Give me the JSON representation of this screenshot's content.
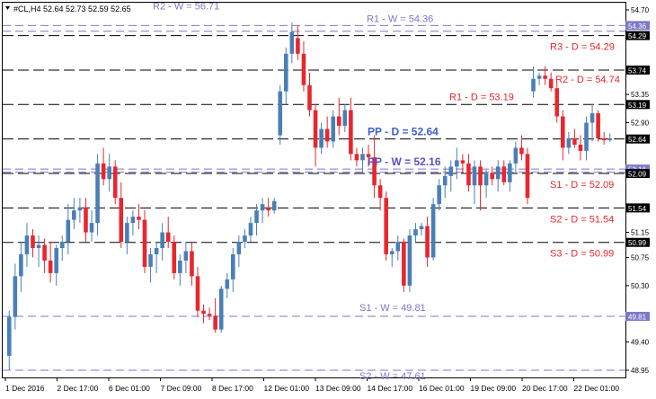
{
  "symbol_header": "#CL,H4  52.64 52.73 52.59 52.65",
  "colors": {
    "bull": "#4a7fb5",
    "bear": "#e8262e",
    "daily": "#000000",
    "weekly": "#7b78c8",
    "daily_text": "#e8262e",
    "pp_daily_text": "#3a5fcd",
    "pp_weekly_text": "#5a4fc0"
  },
  "chart_data": {
    "type": "candlestick",
    "title": "#CL,H4  52.64 52.73 52.59 52.65",
    "ylim": [
      48.95,
      54.7
    ],
    "y_ticks": [
      "54.70",
      "54.29",
      "53.74",
      "53.35",
      "52.90",
      "52.64",
      "52.09",
      "51.54",
      "51.15",
      "50.99",
      "50.75",
      "50.30",
      "49.81",
      "49.40",
      "48.95"
    ],
    "x_tick_labels": [
      "1 Dec 2016",
      "2 Dec 17:00",
      "6 Dec 01:00",
      "7 Dec 09:00",
      "8 Dec 17:00",
      "12 Dec 01:00",
      "13 Dec 09:00",
      "14 Dec 17:00",
      "16 Dec 01:00",
      "19 Dec 09:00",
      "20 Dec 17:00",
      "22 Dec 01:00"
    ],
    "levels": [
      {
        "label": "R2 - W = 56.71",
        "value": 54.45,
        "kind": "weekly",
        "axis_label": "54.36",
        "text_pos": "left"
      },
      {
        "label": "R1 - W = 54.36",
        "value": 54.36,
        "kind": "weekly",
        "axis_label": "",
        "text_pos": "center"
      },
      {
        "label": "R3 - D = 54.29",
        "value": 54.29,
        "kind": "daily",
        "axis_label": "54.29",
        "text_pos": "right"
      },
      {
        "label": "R2 - D = 54.74",
        "value": 53.74,
        "kind": "daily",
        "axis_label": "53.74",
        "text_pos": "right2"
      },
      {
        "label": "R1 - D = 53.19",
        "value": 53.19,
        "kind": "daily",
        "axis_label": "53.19",
        "text_pos": "right1"
      },
      {
        "label": "PP - D = 52.64",
        "value": 52.64,
        "kind": "daily",
        "axis_label": "52.64",
        "text_pos": "pp"
      },
      {
        "label": "PP - W = 52.16",
        "value": 52.16,
        "kind": "weekly",
        "axis_label": "52.16",
        "text_pos": "ppw"
      },
      {
        "label": "",
        "value": 52.11,
        "kind": "weekly",
        "axis_label": "",
        "text_pos": "none"
      },
      {
        "label": "S1 - D = 52.09",
        "value": 52.09,
        "kind": "daily",
        "axis_label": "52.09",
        "text_pos": "right"
      },
      {
        "label": "S2 - D = 51.54",
        "value": 51.54,
        "kind": "daily",
        "axis_label": "51.54",
        "text_pos": "right"
      },
      {
        "label": "S3 - D = 50.99",
        "value": 50.99,
        "kind": "daily",
        "axis_label": "50.99",
        "text_pos": "right"
      },
      {
        "label": "S1 - W = 49.81",
        "value": 49.81,
        "kind": "weekly",
        "axis_label": "49.81",
        "text_pos": "center"
      },
      {
        "label": "S2 - W = 47.61",
        "value": 48.95,
        "kind": "weekly",
        "axis_label": "",
        "text_pos": "bottom"
      }
    ],
    "candles": [
      [
        49.18,
        49.9,
        48.95,
        49.8
      ],
      [
        49.8,
        50.65,
        49.6,
        50.45
      ],
      [
        50.45,
        51.0,
        50.2,
        50.8
      ],
      [
        50.8,
        51.3,
        50.6,
        51.1
      ],
      [
        51.1,
        51.2,
        50.75,
        50.9
      ],
      [
        50.9,
        51.1,
        50.6,
        50.95
      ],
      [
        50.95,
        51.05,
        50.5,
        50.7
      ],
      [
        50.7,
        51.0,
        50.35,
        50.5
      ],
      [
        50.5,
        50.95,
        50.3,
        50.9
      ],
      [
        50.9,
        51.1,
        50.7,
        51.0
      ],
      [
        51.0,
        51.6,
        50.8,
        51.35
      ],
      [
        51.35,
        51.7,
        51.2,
        51.5
      ],
      [
        51.5,
        51.7,
        51.3,
        51.55
      ],
      [
        51.55,
        51.7,
        51.0,
        51.15
      ],
      [
        51.15,
        51.5,
        51.0,
        51.3
      ],
      [
        51.3,
        52.4,
        51.1,
        52.25
      ],
      [
        52.25,
        52.5,
        51.9,
        52.0
      ],
      [
        52.0,
        52.4,
        51.8,
        52.2
      ],
      [
        52.2,
        52.3,
        51.6,
        51.7
      ],
      [
        51.7,
        51.95,
        50.9,
        51.0
      ],
      [
        51.0,
        51.4,
        50.8,
        51.3
      ],
      [
        51.3,
        51.5,
        51.1,
        51.4
      ],
      [
        51.4,
        51.6,
        51.2,
        51.35
      ],
      [
        51.35,
        51.5,
        50.5,
        50.6
      ],
      [
        50.6,
        50.9,
        50.35,
        50.8
      ],
      [
        50.8,
        51.0,
        50.5,
        50.9
      ],
      [
        50.9,
        51.3,
        50.7,
        51.15
      ],
      [
        51.15,
        51.4,
        50.9,
        51.0
      ],
      [
        51.0,
        51.1,
        50.4,
        50.5
      ],
      [
        50.5,
        50.8,
        50.3,
        50.7
      ],
      [
        50.7,
        51.0,
        50.5,
        50.85
      ],
      [
        50.85,
        51.0,
        50.3,
        50.45
      ],
      [
        50.45,
        50.6,
        49.8,
        49.9
      ],
      [
        49.9,
        50.0,
        49.7,
        49.85
      ],
      [
        49.85,
        49.95,
        49.75,
        49.82
      ],
      [
        49.82,
        50.1,
        49.55,
        49.6
      ],
      [
        49.6,
        50.3,
        49.55,
        50.25
      ],
      [
        50.25,
        50.5,
        50.1,
        50.4
      ],
      [
        50.4,
        50.9,
        50.2,
        50.8
      ],
      [
        50.8,
        51.1,
        50.6,
        51.0
      ],
      [
        51.0,
        51.2,
        50.9,
        51.1
      ],
      [
        51.1,
        51.4,
        51.0,
        51.3
      ],
      [
        51.3,
        51.6,
        51.1,
        51.5
      ],
      [
        51.5,
        51.7,
        51.3,
        51.6
      ],
      [
        51.55,
        51.7,
        51.4,
        51.5
      ],
      [
        51.5,
        51.7,
        51.45,
        51.65
      ],
      [
        52.7,
        53.5,
        52.55,
        53.4
      ],
      [
        53.4,
        54.1,
        53.2,
        54.0
      ],
      [
        54.0,
        54.5,
        53.85,
        54.35
      ],
      [
        54.25,
        54.45,
        53.9,
        54.0
      ],
      [
        54.0,
        54.2,
        53.4,
        53.5
      ],
      [
        53.5,
        53.7,
        53.0,
        53.1
      ],
      [
        53.1,
        53.2,
        52.2,
        52.5
      ],
      [
        52.5,
        52.9,
        52.4,
        52.8
      ],
      [
        52.8,
        53.0,
        52.5,
        52.6
      ],
      [
        52.6,
        53.1,
        52.5,
        53.0
      ],
      [
        53.0,
        53.3,
        52.7,
        52.85
      ],
      [
        52.85,
        53.2,
        52.75,
        53.1
      ],
      [
        53.1,
        53.3,
        52.3,
        52.4
      ],
      [
        52.4,
        52.5,
        52.2,
        52.3
      ],
      [
        52.3,
        52.5,
        52.1,
        52.4
      ],
      [
        52.4,
        52.55,
        52.2,
        52.35
      ],
      [
        52.35,
        52.7,
        51.7,
        51.9
      ],
      [
        51.9,
        52.0,
        51.5,
        51.7
      ],
      [
        51.7,
        51.8,
        50.7,
        50.8
      ],
      [
        50.8,
        50.9,
        50.6,
        50.85
      ],
      [
        50.85,
        51.1,
        50.7,
        51.0
      ],
      [
        51.0,
        51.05,
        50.2,
        50.3
      ],
      [
        50.3,
        51.2,
        50.2,
        51.1
      ],
      [
        51.1,
        51.3,
        51.0,
        51.2
      ],
      [
        51.2,
        51.3,
        51.1,
        51.25
      ],
      [
        51.25,
        51.4,
        50.6,
        50.75
      ],
      [
        50.75,
        51.7,
        50.7,
        51.6
      ],
      [
        51.6,
        52.0,
        51.5,
        51.9
      ],
      [
        51.9,
        52.2,
        51.7,
        52.05
      ],
      [
        52.05,
        52.3,
        51.8,
        52.2
      ],
      [
        52.2,
        52.5,
        52.0,
        52.3
      ],
      [
        52.3,
        52.4,
        52.1,
        52.25
      ],
      [
        52.25,
        52.4,
        51.8,
        51.9
      ],
      [
        51.9,
        52.3,
        51.6,
        52.2
      ],
      [
        52.2,
        52.3,
        51.5,
        51.9
      ],
      [
        51.9,
        52.15,
        51.7,
        52.1
      ],
      [
        52.1,
        52.2,
        51.9,
        52.0
      ],
      [
        52.0,
        52.3,
        51.8,
        52.2
      ],
      [
        52.2,
        52.3,
        51.9,
        51.95
      ],
      [
        51.95,
        52.3,
        51.8,
        52.25
      ],
      [
        52.25,
        52.6,
        52.1,
        52.5
      ],
      [
        52.5,
        52.7,
        52.3,
        52.4
      ],
      [
        52.4,
        52.5,
        51.6,
        51.7
      ],
      [
        53.4,
        53.8,
        53.3,
        53.6
      ],
      [
        53.6,
        53.7,
        53.5,
        53.65
      ],
      [
        53.65,
        53.8,
        53.5,
        53.6
      ],
      [
        53.6,
        53.7,
        53.4,
        53.45
      ],
      [
        53.45,
        53.55,
        52.9,
        53.0
      ],
      [
        53.0,
        53.1,
        52.3,
        52.5
      ],
      [
        52.5,
        52.75,
        52.4,
        52.65
      ],
      [
        52.65,
        52.8,
        52.5,
        52.55
      ],
      [
        52.55,
        52.7,
        52.3,
        52.45
      ],
      [
        52.45,
        53.0,
        52.3,
        52.9
      ],
      [
        52.9,
        53.2,
        52.6,
        53.05
      ],
      [
        53.05,
        53.1,
        52.6,
        52.65
      ],
      [
        52.65,
        52.75,
        52.55,
        52.62
      ],
      [
        52.62,
        52.73,
        52.59,
        52.65
      ]
    ]
  }
}
